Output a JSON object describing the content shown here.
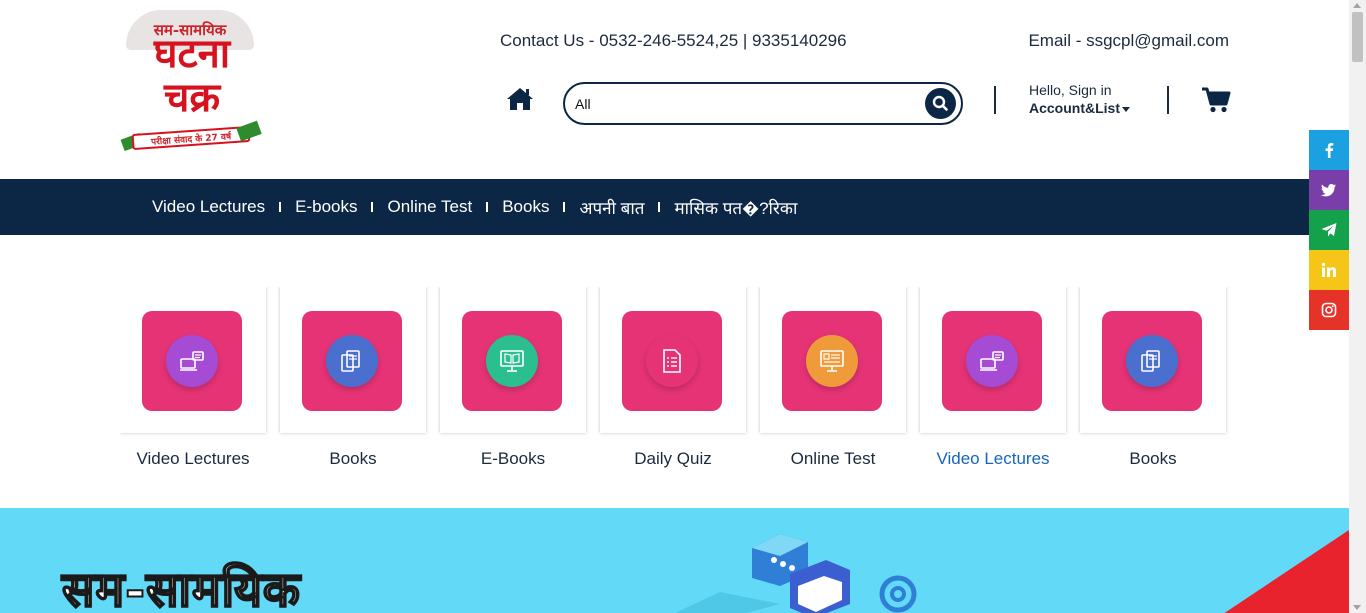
{
  "logo": {
    "top_text": "सम-सामयिक",
    "line1": "घटना",
    "line2": "चक्र",
    "ribbon_text": "परीक्षा संवाद के 27 वर्ष"
  },
  "header": {
    "contact": "Contact Us - 0532-246-5524,25 | 9335140296",
    "email": "Email - ssgcpl@gmail.com",
    "search_value": "All",
    "signin_hello": "Hello, Sign in",
    "signin_account": "Account&List"
  },
  "nav": {
    "items": [
      {
        "label": "Video Lectures"
      },
      {
        "label": "E-books"
      },
      {
        "label": "Online Test"
      },
      {
        "label": "Books"
      },
      {
        "label": "अपनी बात"
      },
      {
        "label": "मासिक पत�?रिका"
      }
    ]
  },
  "categories": {
    "items": [
      {
        "label": "Video Lectures",
        "icon": "video-lecture-icon",
        "color": "#a64bd3"
      },
      {
        "label": "Books",
        "icon": "books-icon",
        "color": "#4a6fcf"
      },
      {
        "label": "E-Books",
        "icon": "ebook-icon",
        "color": "#2bbf8f"
      },
      {
        "label": "Daily Quiz",
        "icon": "quiz-icon",
        "color": "#e53376"
      },
      {
        "label": "Online Test",
        "icon": "online-test-icon",
        "color": "#f09b3a"
      },
      {
        "label": "Video Lectures",
        "icon": "video-lecture-icon",
        "color": "#a64bd3"
      },
      {
        "label": "Books",
        "icon": "books-icon",
        "color": "#4a6fcf"
      }
    ],
    "active_index": 5
  },
  "banner": {
    "title": "सम-सामयिक"
  },
  "social": [
    {
      "name": "facebook-icon",
      "color": "#1ba1e2"
    },
    {
      "name": "twitter-icon",
      "color": "#7a3ea8"
    },
    {
      "name": "telegram-icon",
      "color": "#13a24b"
    },
    {
      "name": "linkedin-icon",
      "color": "#f5c518"
    },
    {
      "name": "instagram-icon",
      "color": "#e63329"
    }
  ],
  "colors": {
    "navy": "#0b2745",
    "tile_pink": "#e53376",
    "banner_cyan": "#62d9f6",
    "active_link": "#1565c0"
  }
}
